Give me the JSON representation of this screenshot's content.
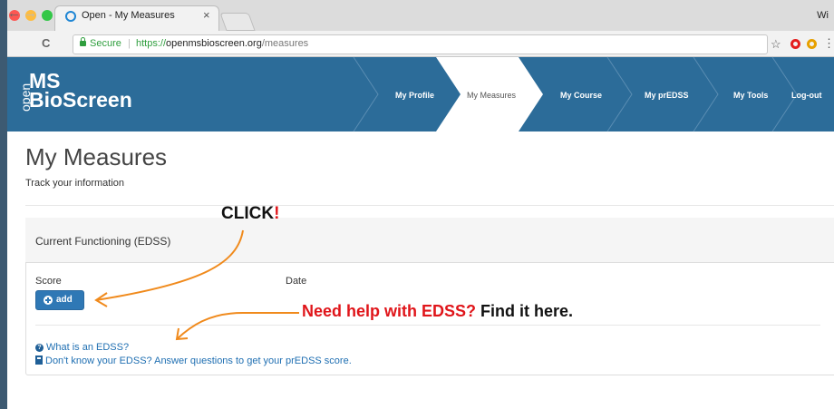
{
  "browser": {
    "tab_title": "Open - My Measures",
    "tab_close": "×",
    "profile": "Wi",
    "secure_label": "Secure",
    "url_scheme": "https://",
    "url_host": "openmsbioscreen.org",
    "url_path": "/measures",
    "back": "←",
    "forward": "→",
    "reload": "C",
    "star": "☆",
    "menu": "⋮"
  },
  "site": {
    "logo_open": "open",
    "logo_ms": "MS",
    "logo_bioscreen": "BioScreen",
    "nav": [
      {
        "label": "My Profile",
        "active": false
      },
      {
        "label": "My Measures",
        "active": true
      },
      {
        "label": "My Course",
        "active": false
      },
      {
        "label": "My prEDSS",
        "active": false
      },
      {
        "label": "My Tools",
        "active": false
      },
      {
        "label": "Log-out",
        "active": false
      }
    ],
    "header_color": "#2c6c99"
  },
  "page": {
    "title": "My Measures",
    "subtitle": "Track your information"
  },
  "panel": {
    "title": "Current Functioning (EDSS)",
    "col_score": "Score",
    "col_date": "Date",
    "add_label": "add",
    "help_link_1": "What is an EDSS?",
    "help_link_2": "Don't know your EDSS? Answer questions to get your prEDSS score."
  },
  "annotations": {
    "click_text": "CLICK",
    "click_bang": "!",
    "help_text_red": "Need help with EDSS?",
    "help_text_black": "Find it here.",
    "arrow_color": "#f08a1c",
    "red": "#e0151a"
  }
}
